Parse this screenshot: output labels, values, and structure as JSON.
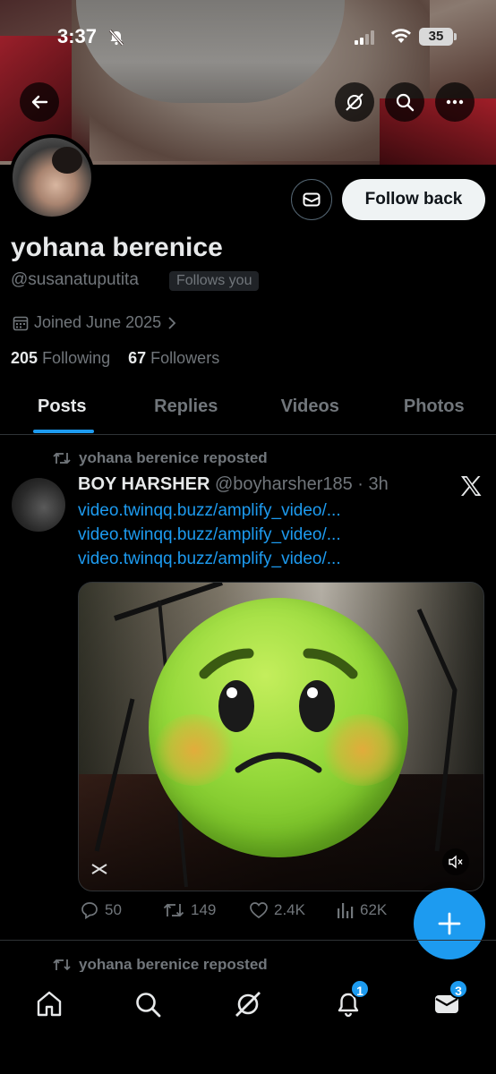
{
  "status_bar": {
    "time": "3:37",
    "battery": "35"
  },
  "profile": {
    "name": "yohana berenice",
    "handle": "@susanatuputita",
    "follows_you": "Follows you",
    "joined": "Joined June 2025",
    "following_count": "205",
    "following_label": "Following",
    "followers_count": "67",
    "followers_label": "Followers",
    "follow_button": "Follow back"
  },
  "tabs": [
    {
      "label": "Posts",
      "active": true
    },
    {
      "label": "Replies",
      "active": false
    },
    {
      "label": "Videos",
      "active": false
    },
    {
      "label": "Photos",
      "active": false
    }
  ],
  "post": {
    "repost_label": "yohana berenice reposted",
    "author": "BOY HARSHER",
    "meta": "@boyharsher185 · 3h",
    "links": [
      "video.twinqq.buzz/amplify_video/...",
      "video.twinqq.buzz/amplify_video/...",
      "video.twinqq.buzz/amplify_video/..."
    ],
    "replies": "50",
    "reposts": "149",
    "likes": "2.4K",
    "views": "62K"
  },
  "next_post": {
    "repost_label": "yohana berenice reposted"
  },
  "nav": {
    "notifications_badge": "1",
    "messages_badge": "3"
  },
  "colors": {
    "accent": "#1d9bf0",
    "background": "#000000",
    "muted": "#71767b"
  }
}
